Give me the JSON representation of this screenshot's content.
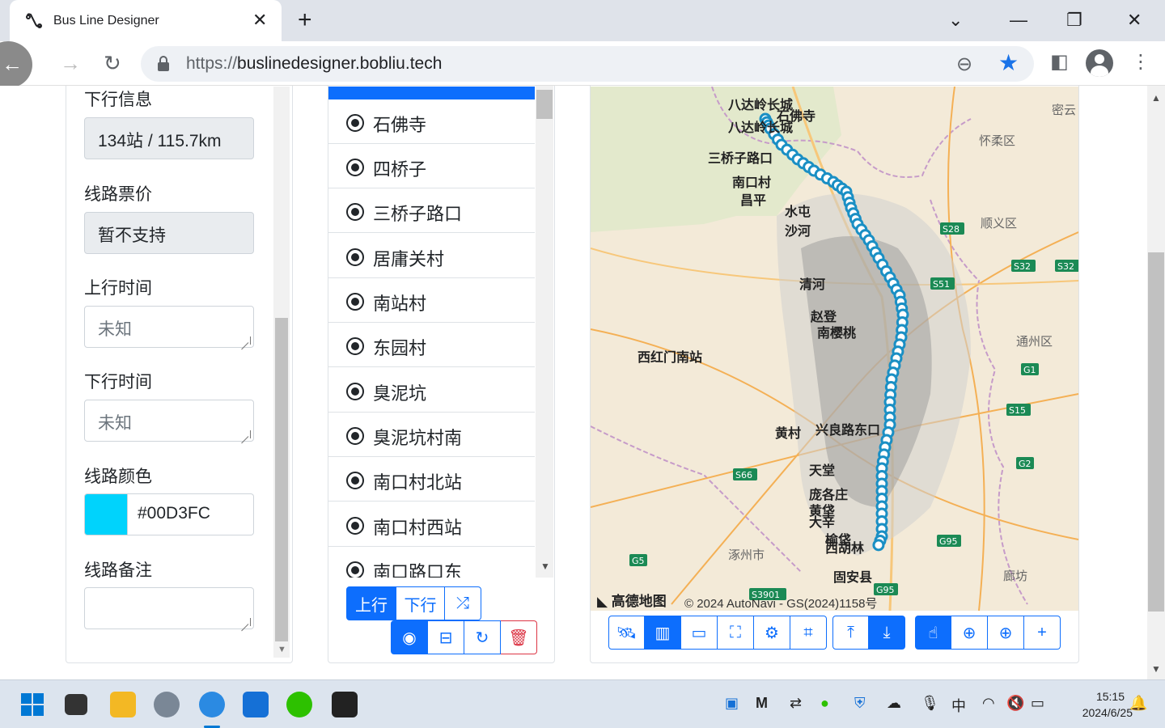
{
  "browser": {
    "tab_title": "Bus Line Designer",
    "url_scheme": "https://",
    "url_host": "buslinedesigner.bobliu.tech"
  },
  "form": {
    "down_info_label": "下行信息",
    "down_info_value": "134站 / 115.7km",
    "fare_label": "线路票价",
    "fare_value": "暂不支持",
    "up_time_label": "上行时间",
    "up_time_placeholder": "未知",
    "down_time_label": "下行时间",
    "down_time_placeholder": "未知",
    "color_label": "线路颜色",
    "color_value": "#00D3FC",
    "note_label": "线路备注"
  },
  "stations": [
    "石佛寺",
    "四桥子",
    "三桥子路口",
    "居庸关村",
    "南站村",
    "东园村",
    "臭泥坑",
    "臭泥坑村南",
    "南口村北站",
    "南口村西站",
    "南口路口东"
  ],
  "direction_buttons": {
    "up": "上行",
    "down": "下行"
  },
  "map": {
    "logo": "高德地图",
    "copyright": "© 2024 AutoNavi - GS(2024)1158号",
    "labels": [
      "八达岭长城",
      "石佛寺",
      "八达岭长城",
      "三桥子路口",
      "南口村",
      "昌平",
      "水屯",
      "沙河",
      "清河",
      "赵登",
      "南樱桃",
      "西红门南站",
      "黄村",
      "兴良路东口",
      "天堂",
      "庞各庄",
      "黄垡",
      "大辛",
      "榆垡",
      "西胡林",
      "固安县",
      "涿州市",
      "廊坊",
      "怀柔区",
      "顺义区",
      "通州区",
      "密云"
    ],
    "road_badges": [
      "S28",
      "S32",
      "S32",
      "S51",
      "G1",
      "S15",
      "G2",
      "S66",
      "G5",
      "G95",
      "S3901",
      "G95"
    ],
    "route_color": "#1a8fc4"
  },
  "taskbar": {
    "ime": "中",
    "time": "15:15",
    "date": "2024/6/25"
  }
}
